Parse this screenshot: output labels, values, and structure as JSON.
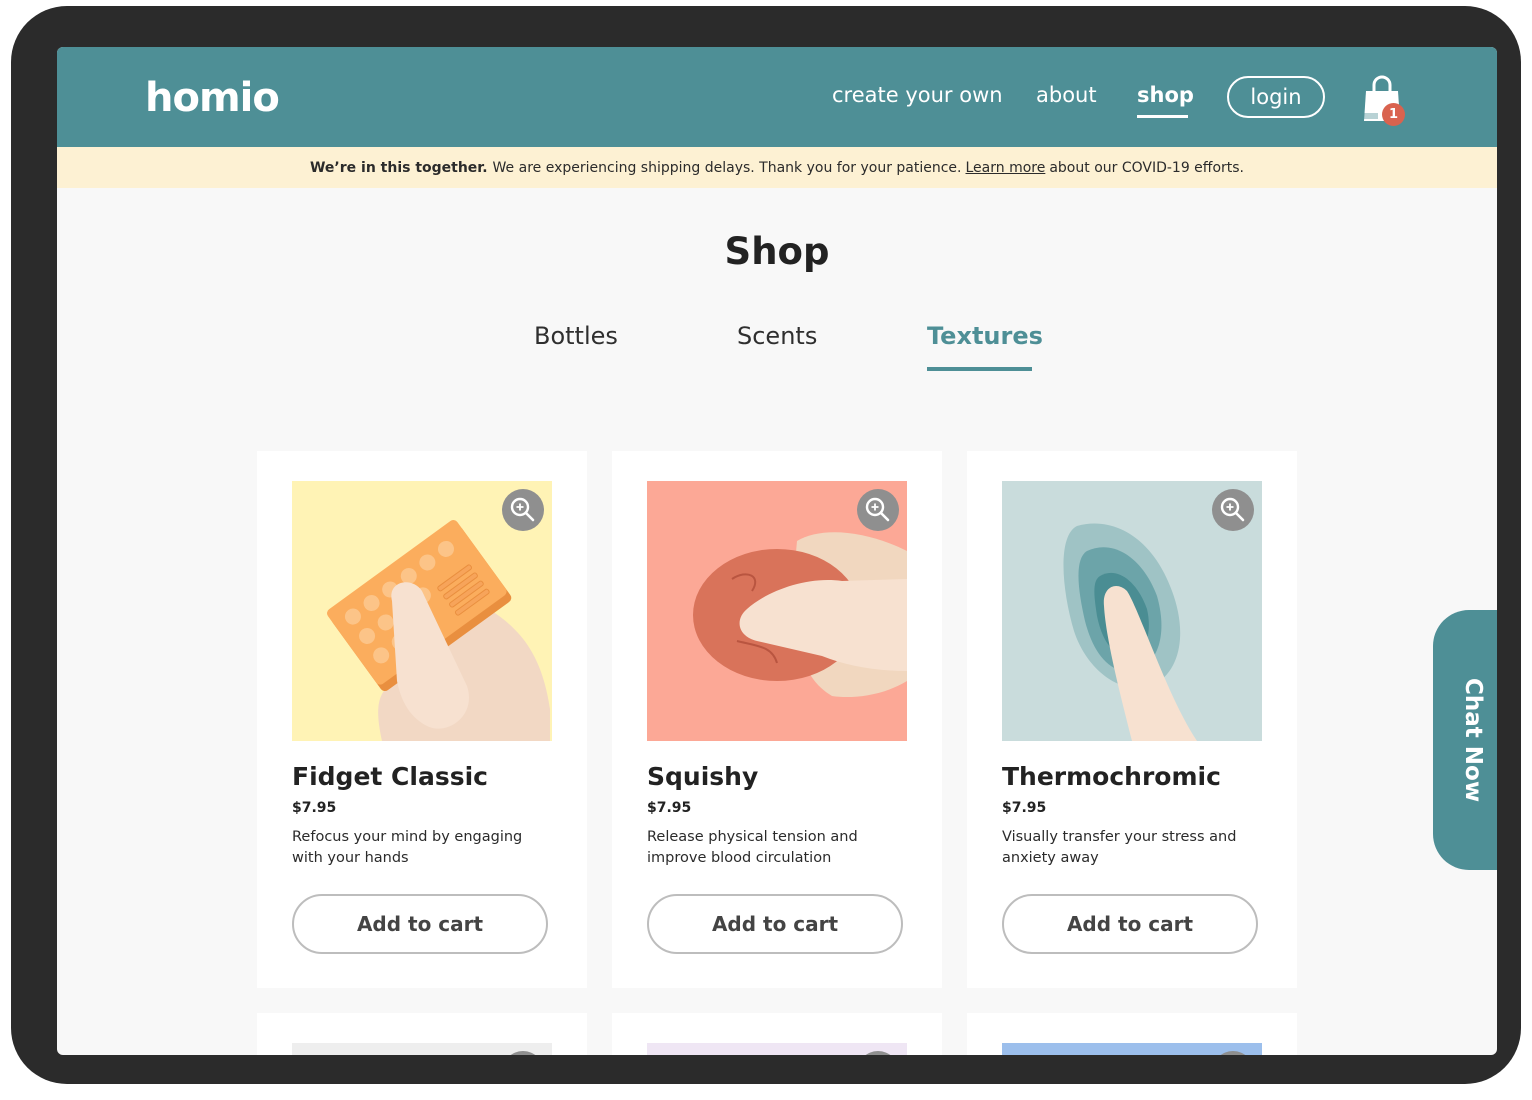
{
  "header": {
    "logo": "homio",
    "nav": [
      "create your own",
      "about",
      "shop"
    ],
    "login": "login",
    "cart_count": "1",
    "brand_color": "#4e8f96"
  },
  "banner": {
    "bold": "We’re in this together.",
    "text": "We are experiencing shipping delays. Thank you for your patience.",
    "link": "Learn more",
    "tail": "about our COVID-19 efforts."
  },
  "page": {
    "title": "Shop",
    "tabs": [
      "Bottles",
      "Scents",
      "Textures"
    ],
    "active_tab": "Textures"
  },
  "products": [
    {
      "name": "Fidget Classic",
      "price": "$7.95",
      "description": "Refocus your mind by engaging with your hands",
      "button": "Add to cart",
      "bg": "#fff3b5"
    },
    {
      "name": "Squishy",
      "price": "$7.95",
      "description": "Release physical tension and improve blood circulation",
      "button": "Add to cart",
      "bg": "#fca896"
    },
    {
      "name": "Thermochromic",
      "price": "$7.95",
      "description": "Visually transfer your stress and anxiety away",
      "button": "Add to cart",
      "bg": "#c9dcdc"
    }
  ],
  "chat": {
    "label": "Chat Now"
  }
}
